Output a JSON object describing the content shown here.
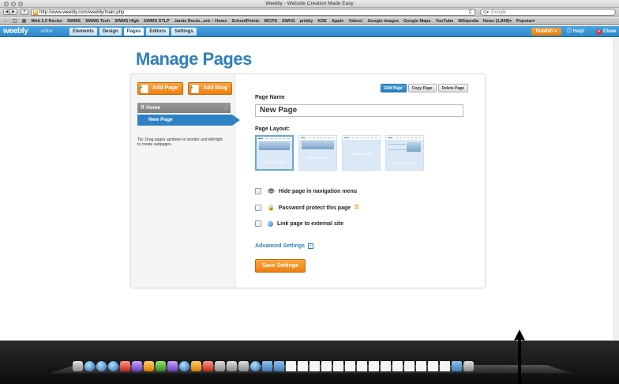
{
  "window": {
    "title": "Weebly - Website Creation Made Easy"
  },
  "browser": {
    "url": "http://www.weebly.com/weebly/main.php",
    "search_placeholder": "Google",
    "bookmarks": [
      "Web 2.0 Rector",
      "SWMS",
      "SWMS Tech",
      "SWMS HIgh",
      "SWMS STLP",
      "Jamie Recto...ent – Home",
      "SchoolPointe",
      "WCPS",
      "SWHS",
      "priddy",
      "KDE",
      "Apple",
      "Yahoo!",
      "Google Images",
      "Google Maps",
      "YouTube",
      "Wikipedia",
      "News (1,849)▾",
      "Popular▾"
    ]
  },
  "editor": {
    "logo": "weebly",
    "logo_sub": "editor",
    "tabs": [
      "Elements",
      "Design",
      "Pages",
      "Editors",
      "Settings"
    ],
    "active_tab": "Pages",
    "publish_label": "Publish »",
    "help_label": "Help!",
    "close_label": "Close"
  },
  "page": {
    "heading": "Manage Pages",
    "add_page_label": "Add Page",
    "add_blog_label": "Add Blog",
    "pages": [
      {
        "label": "Home",
        "is_home": true
      },
      {
        "label": "New Page",
        "selected": true
      }
    ],
    "tip": "Tip: Drag pages up/down to reorder and left/right to create subpages.",
    "actions": [
      "Edit Page",
      "Copy Page",
      "Delete Page"
    ],
    "page_name_label": "Page Name",
    "page_name_value": "New Page",
    "page_layout_label": "Page Layout:",
    "layouts": [
      {
        "content_label": "Content Area",
        "selected": true
      },
      {
        "content_label": "Content Area"
      },
      {
        "content_label": "Content Area"
      },
      {
        "content_label": "Content Area"
      }
    ],
    "options": [
      {
        "label": "Hide page in navigation menu",
        "icon": "eye-icon",
        "checked": false
      },
      {
        "label": "Password protect this page",
        "icon": "lock-icon",
        "checked": false
      },
      {
        "label": "Link page to external site",
        "icon": "globe-icon",
        "checked": false
      }
    ],
    "advanced_label": "Advanced Settings",
    "save_label": "Save Settings"
  },
  "colors": {
    "accent_blue": "#2e7fbf",
    "accent_orange": "#ee7f0f"
  }
}
